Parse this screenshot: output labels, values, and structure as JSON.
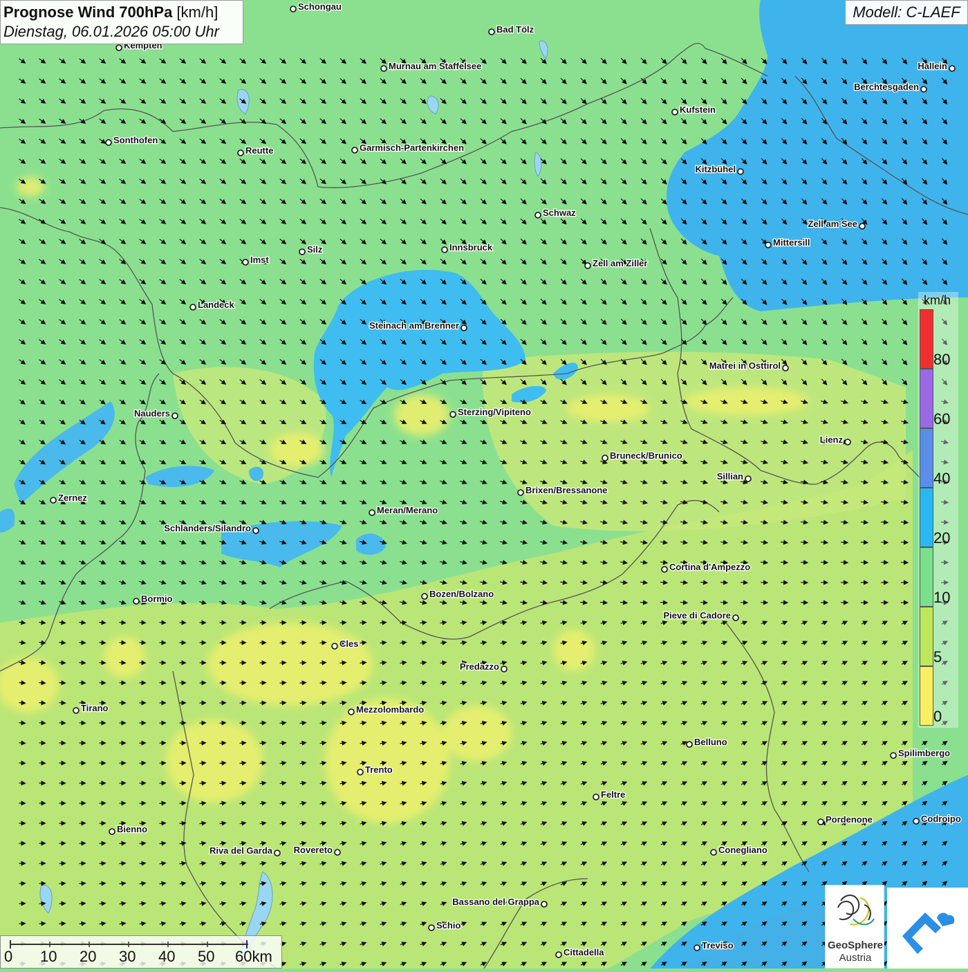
{
  "header": {
    "title_bold": "Prognose Wind 700hPa",
    "title_unit": "[km/h]",
    "datetime": "Dienstag, 06.01.2026 05:00 Uhr",
    "model": "Modell: C-LAEF"
  },
  "legend": {
    "unit": "km/h",
    "labels": [
      "80",
      "60",
      "40",
      "20",
      "10",
      "5",
      "0"
    ],
    "colors": [
      "#f03030",
      "#9a6ae6",
      "#5a8ee8",
      "#2ab8f0",
      "#7ae08c",
      "#bce85a",
      "#f8f060"
    ]
  },
  "scalebar": {
    "labels": [
      "0",
      "10",
      "20",
      "30",
      "40",
      "50",
      "60km"
    ]
  },
  "logo": {
    "name": "GeoSphere",
    "sub": "Austria"
  },
  "cities": [
    {
      "name": "Schongau"
    },
    {
      "name": "Bad Tölz"
    },
    {
      "name": "Kempten"
    },
    {
      "name": "Murnau am Staffelsee"
    },
    {
      "name": "Hallein"
    },
    {
      "name": "Berchtesgaden"
    },
    {
      "name": "Kufstein"
    },
    {
      "name": "Sonthofen"
    },
    {
      "name": "Reutte"
    },
    {
      "name": "Garmisch-Partenkirchen"
    },
    {
      "name": "Kitzbühel"
    },
    {
      "name": "Schwaz"
    },
    {
      "name": "Zell am See"
    },
    {
      "name": "Mittersill"
    },
    {
      "name": "Innsbruck"
    },
    {
      "name": "Silz"
    },
    {
      "name": "Imst"
    },
    {
      "name": "Zell am Ziller"
    },
    {
      "name": "Landeck"
    },
    {
      "name": "Steinach am Brenner"
    },
    {
      "name": "Matrei in Osttirol"
    },
    {
      "name": "Nauders"
    },
    {
      "name": "Sterzing/Vipiteno"
    },
    {
      "name": "Lienz"
    },
    {
      "name": "Bruneck/Brunico"
    },
    {
      "name": "Sillian"
    },
    {
      "name": "Brixen/Bressanone"
    },
    {
      "name": "Zernez"
    },
    {
      "name": "Meran/Merano"
    },
    {
      "name": "Schlanders/Silandro"
    },
    {
      "name": "Cortina d'Ampezzo"
    },
    {
      "name": "Bozen/Bolzano"
    },
    {
      "name": "Bormio"
    },
    {
      "name": "Pieve di Cadore"
    },
    {
      "name": "Cles"
    },
    {
      "name": "Predazzo"
    },
    {
      "name": "Tirano"
    },
    {
      "name": "Mezzolombardo"
    },
    {
      "name": "Belluno"
    },
    {
      "name": "Spilimbergo"
    },
    {
      "name": "Trento"
    },
    {
      "name": "Feltre"
    },
    {
      "name": "Bienno"
    },
    {
      "name": "Pordenone"
    },
    {
      "name": "Codroipo"
    },
    {
      "name": "Riva del Garda"
    },
    {
      "name": "Rovereto"
    },
    {
      "name": "Conegliano"
    },
    {
      "name": "Bassano del Grappa"
    },
    {
      "name": "Schio"
    },
    {
      "name": "Treviso"
    },
    {
      "name": "Cittadella"
    }
  ]
}
